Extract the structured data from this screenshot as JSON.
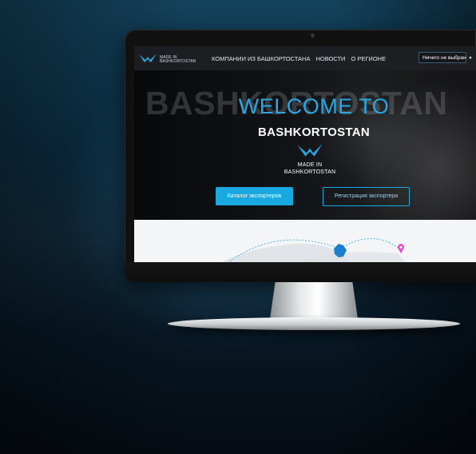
{
  "site": {
    "logo_text": "MADE IN BASHKORTOSTAN",
    "nav": {
      "links": [
        {
          "label": "КОМПАНИИ ИЗ БАШКОРТОСТАНА"
        },
        {
          "label": "НОВОСТИ"
        },
        {
          "label": "О РЕГИОНЕ"
        }
      ],
      "select_value": "Ничего не выбран"
    },
    "hero": {
      "background_word": "BASHKORTOSTAN",
      "welcome": "WELCOME TO",
      "region": "BASHKORTOSTAN",
      "logo_line1": "MADE IN",
      "logo_line2": "BASHKORTOSTAN",
      "primary_button": "Каталог экспортеров",
      "secondary_button": "Регистрация экспортера"
    }
  },
  "colors": {
    "accent": "#1aa8e0",
    "nav_bg": "#1e2024",
    "map_bg": "#f3f5f7",
    "pin": "#e04fd0"
  },
  "icons": [
    "bird-logo-icon",
    "chevron-down-icon",
    "map-pin-icon"
  ]
}
